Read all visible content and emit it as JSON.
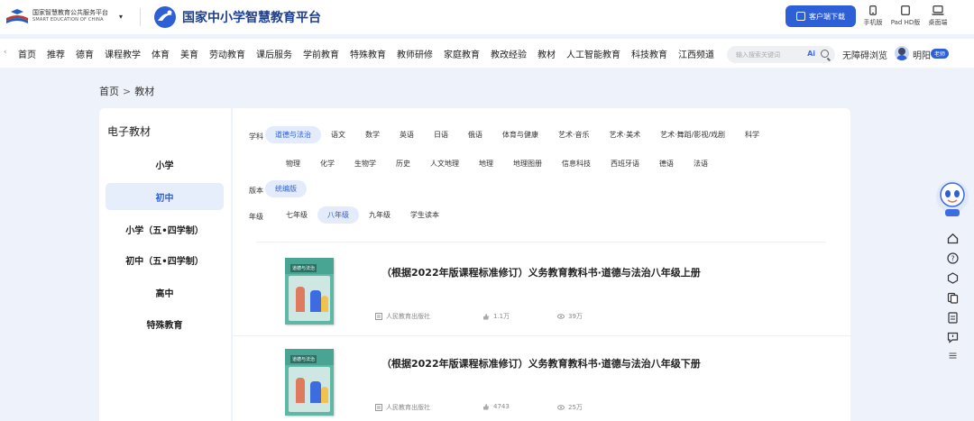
{
  "header": {
    "gov_title": "国家智慧教育公共服务平台",
    "gov_subtitle": "SMART EDUCATION OF CHINA",
    "site_title": "国家中小学智慧教育平台",
    "download_label": "客户端下载",
    "devices": [
      {
        "label": "手机版",
        "icon": "phone-icon"
      },
      {
        "label": "Pad HD版",
        "icon": "tablet-icon"
      },
      {
        "label": "桌面端",
        "icon": "laptop-icon"
      }
    ]
  },
  "nav": {
    "items": [
      "首页",
      "推荐",
      "德育",
      "课程教学",
      "体育",
      "美育",
      "劳动教育",
      "课后服务",
      "学前教育",
      "特殊教育",
      "教师研修",
      "家庭教育",
      "教改经验",
      "教材",
      "人工智能教育",
      "科技教育",
      "江西频道"
    ],
    "search_placeholder": "输入搜索关键词",
    "ai_label": "Ai",
    "accessibility_label": "无障碍浏览",
    "user_name": "明阳",
    "user_badge": "老师"
  },
  "breadcrumb": {
    "home": "首页",
    "separator": ">",
    "current": "教材"
  },
  "sidebar": {
    "heading": "电子教材",
    "stages": [
      {
        "label": "小学",
        "active": false
      },
      {
        "label": "初中",
        "active": true
      },
      {
        "label": "小学（五•四学制）",
        "active": false
      },
      {
        "label": "初中（五•四学制）",
        "active": false
      },
      {
        "label": "高中",
        "active": false
      },
      {
        "label": "特殊教育",
        "active": false
      }
    ]
  },
  "filters": {
    "subject_label": "学科",
    "subjects_row1": [
      "道德与法治",
      "语文",
      "数学",
      "英语",
      "日语",
      "俄语",
      "体育与健康",
      "艺术·音乐",
      "艺术·美术",
      "艺术·舞蹈/影视/戏剧",
      "科学"
    ],
    "subjects_row2": [
      "物理",
      "化学",
      "生物学",
      "历史",
      "人文地理",
      "地理",
      "地理图册",
      "信息科技",
      "西班牙语",
      "德语",
      "法语"
    ],
    "selected_subject": "道德与法治",
    "edition_label": "版本",
    "editions": [
      "统编版"
    ],
    "grade_label": "年级",
    "grades": [
      "七年级",
      "八年级",
      "九年级",
      "学生读本"
    ],
    "selected_grade": "八年级"
  },
  "books": [
    {
      "title": "（根据2022年版课程标准修订）义务教育教科书·道德与法治八年级上册",
      "cover_label": "道德与法治",
      "publisher": "人民教育出版社",
      "likes": "1.1万",
      "views": "39万"
    },
    {
      "title": "（根据2022年版课程标准修订）义务教育教科书·道德与法治八年级下册",
      "cover_label": "道德与法治",
      "publisher": "人民教育出版社",
      "likes": "4743",
      "views": "25万"
    }
  ],
  "colors": {
    "accent": "#2d5fd6",
    "page_bg": "#eef2fa",
    "chip_bg": "#e4ecfb"
  }
}
